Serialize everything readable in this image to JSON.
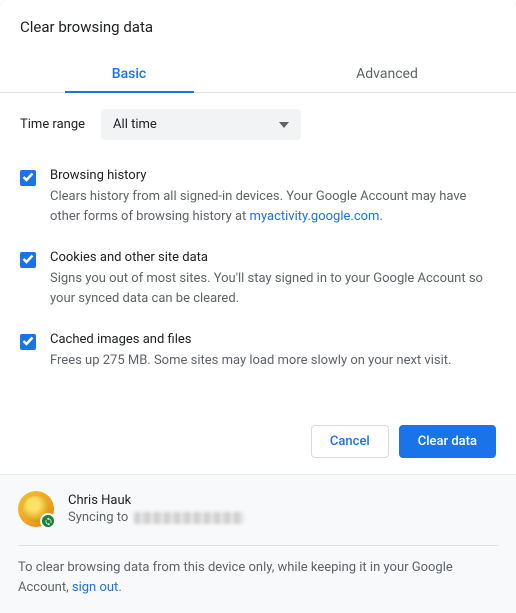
{
  "header": {
    "title": "Clear browsing data"
  },
  "tabs": {
    "basic": "Basic",
    "advanced": "Advanced",
    "active": "basic"
  },
  "time_range": {
    "label": "Time range",
    "value": "All time"
  },
  "options": [
    {
      "checked": true,
      "title": "Browsing history",
      "desc_pre": "Clears history from all signed-in devices. Your Google Account may have other forms of browsing history at ",
      "link_text": "myactivity.google.com",
      "desc_post": "."
    },
    {
      "checked": true,
      "title": "Cookies and other site data",
      "desc": "Signs you out of most sites. You'll stay signed in to your Google Account so your synced data can be cleared."
    },
    {
      "checked": true,
      "title": "Cached images and files",
      "desc": "Frees up 275 MB. Some sites may load more slowly on your next visit."
    }
  ],
  "buttons": {
    "cancel": "Cancel",
    "clear": "Clear data"
  },
  "account": {
    "name": "Chris Hauk",
    "sync_label": "Syncing to"
  },
  "footer_note": {
    "pre": "To clear browsing data from this device only, while keeping it in your Google Account, ",
    "link": "sign out",
    "post": "."
  }
}
